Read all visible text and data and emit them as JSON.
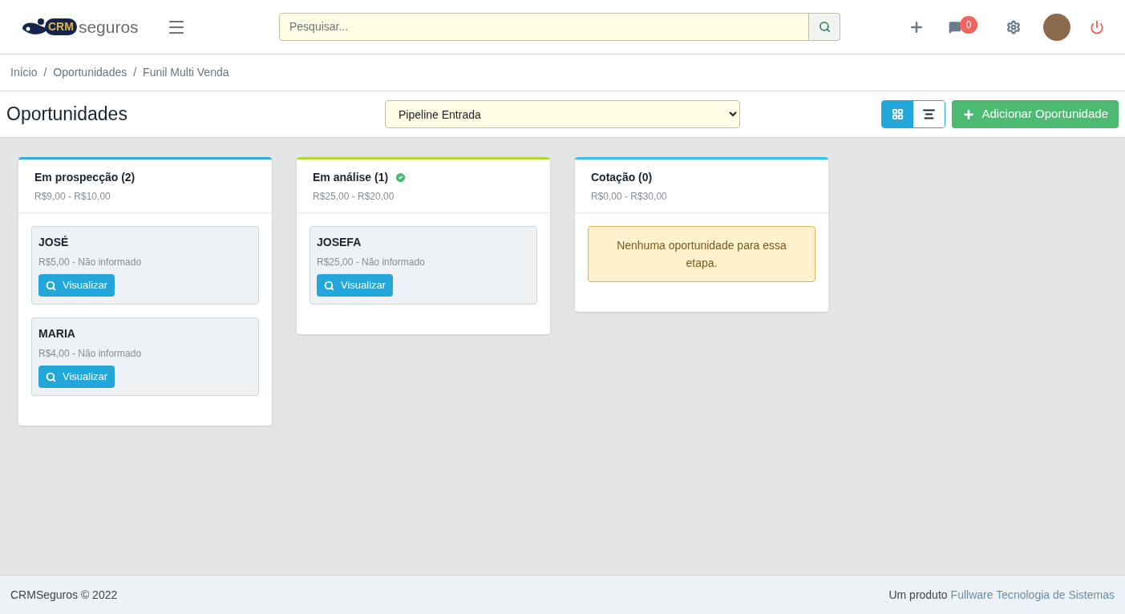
{
  "logo": {
    "mark": "CRM",
    "word": "seguros"
  },
  "search": {
    "placeholder": "Pesquisar..."
  },
  "header": {
    "notifications": "0"
  },
  "breadcrumb": [
    {
      "kind": "link",
      "text": "Início"
    },
    {
      "kind": "separator",
      "text": "/"
    },
    {
      "kind": "link",
      "text": "Oportunidades"
    },
    {
      "kind": "separator",
      "text": "/"
    },
    {
      "kind": "link",
      "text": "Funil Multi Venda"
    }
  ],
  "page_title": "Oportunidades",
  "pipeline_select": {
    "value": "Pipeline Entrada"
  },
  "view_toggle": [
    {
      "kind": "grid",
      "selected": true
    },
    {
      "kind": "list",
      "selected": false
    }
  ],
  "add_button": "Adicionar Oportunidade",
  "columns": [
    {
      "title": "Em prospecção (2)",
      "range": "R$9,00 - R$10,00",
      "color": "#3aa8dd",
      "completed": false,
      "cards": [
        {
          "name": "JOSÉ",
          "detail": "R$5,00 - Não informado",
          "action": "Visualizar"
        },
        {
          "name": "MARIA",
          "detail": "R$4,00 - Não informado",
          "action": "Visualizar"
        }
      ]
    },
    {
      "title": "Em análise (1)",
      "range": "R$25,00 - R$20,00",
      "color": "#b5d82c",
      "completed": true,
      "cards": [
        {
          "name": "JOSEFA",
          "detail": "R$25,00 - Não informado",
          "action": "Visualizar"
        }
      ]
    },
    {
      "title": "Cotação (0)",
      "range": "R$0,00 - R$30,00",
      "color": "#3cbfee",
      "completed": false,
      "empty_message": "Nenhuma oportunidade para essa etapa."
    }
  ],
  "footer": {
    "left": "CRMSeguros © 2022",
    "prefix": "Um produto",
    "link": "Fullware Tecnologia de Sistemas"
  }
}
